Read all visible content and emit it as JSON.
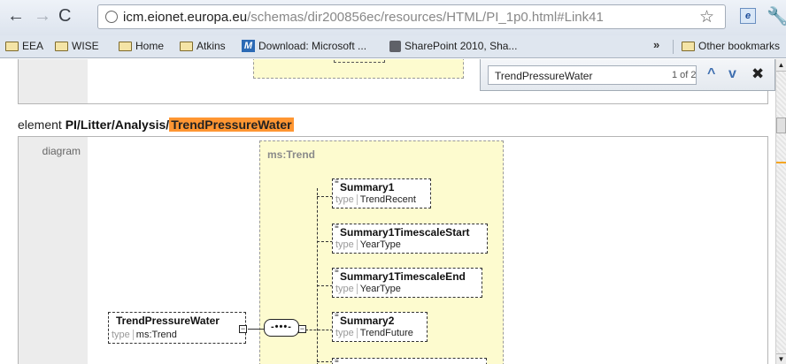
{
  "browser": {
    "url_host": "icm.eionet.europa.eu",
    "url_path": "/schemas/dir200856ec/resources/HTML/PI_1p0.html#Link41",
    "ext_icon_label": "e",
    "bookmarks": [
      "EEA",
      "WISE",
      "Home",
      "Atkins",
      "Download: Microsoft ...",
      "SharePoint 2010, Sha..."
    ],
    "other_bookmarks": "Other bookmarks",
    "overflow": "»"
  },
  "find_bar": {
    "query": "TrendPressureWater",
    "match_count": "1 of 2"
  },
  "element_heading": {
    "prefix": "element ",
    "path": "PI/Litter/Analysis/",
    "highlighted": "TrendPressureWater"
  },
  "diagram": {
    "row_label": "diagram",
    "group_label": "ms:Trend",
    "root": {
      "name": "TrendPressureWater",
      "type_key": "type",
      "type_value": "ms:Trend"
    },
    "children": [
      {
        "name": "Summary1",
        "type_key": "type",
        "type_value": "TrendRecent"
      },
      {
        "name": "Summary1TimescaleStart",
        "type_key": "type",
        "type_value": "YearType"
      },
      {
        "name": "Summary1TimescaleEnd",
        "type_key": "type",
        "type_value": "YearType"
      },
      {
        "name": "Summary2",
        "type_key": "type",
        "type_value": "TrendFuture"
      }
    ]
  },
  "colors": {
    "highlight": "#ff9632",
    "group_fill": "#fdfbcf",
    "link_blue": "#3f6fb0"
  },
  "icons": [
    "back-icon",
    "forward-icon",
    "reload-icon",
    "globe-icon",
    "star-icon",
    "wrench-icon",
    "folder-icon",
    "close-icon"
  ]
}
